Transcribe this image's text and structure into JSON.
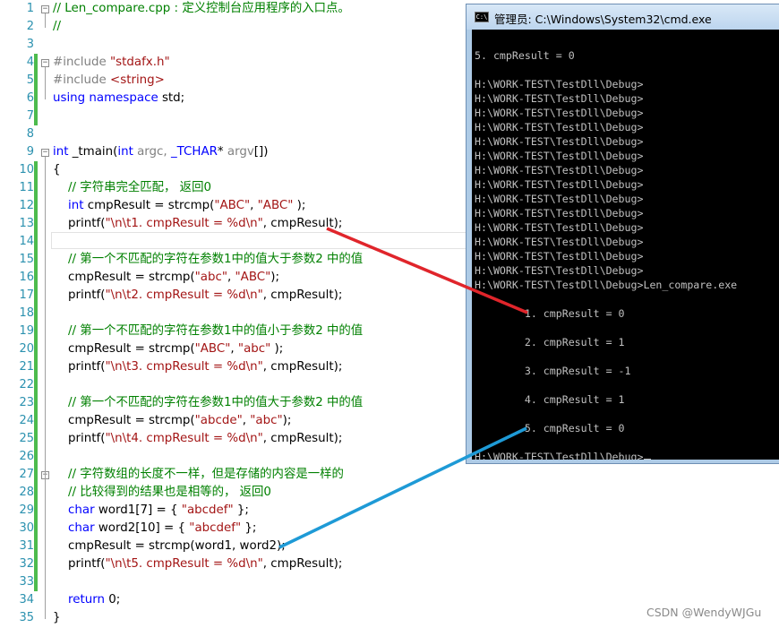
{
  "editor": {
    "lines": [
      {
        "n": "1",
        "segs": [
          {
            "t": "// Len_compare.cpp : 定义控制台应用程序的入口点。",
            "c": "cm"
          }
        ]
      },
      {
        "n": "2",
        "segs": [
          {
            "t": "//",
            "c": "cm"
          }
        ]
      },
      {
        "n": "3",
        "segs": []
      },
      {
        "n": "4",
        "segs": [
          {
            "t": "#include ",
            "c": "pp"
          },
          {
            "t": "\"stdafx.h\"",
            "c": "str"
          }
        ]
      },
      {
        "n": "5",
        "segs": [
          {
            "t": "#include ",
            "c": "pp"
          },
          {
            "t": "<string>",
            "c": "str"
          }
        ]
      },
      {
        "n": "6",
        "segs": [
          {
            "t": "using namespace ",
            "c": "kw"
          },
          {
            "t": "std;",
            "c": ""
          }
        ]
      },
      {
        "n": "7",
        "segs": []
      },
      {
        "n": "8",
        "segs": []
      },
      {
        "n": "9",
        "segs": [
          {
            "t": "int ",
            "c": "kw"
          },
          {
            "t": "_tmain(",
            "c": ""
          },
          {
            "t": "int ",
            "c": "kw"
          },
          {
            "t": "argc, ",
            "c": "pp"
          },
          {
            "t": "_TCHAR",
            "c": "kw"
          },
          {
            "t": "* ",
            "c": ""
          },
          {
            "t": "argv",
            "c": "pp"
          },
          {
            "t": "[])",
            "c": ""
          }
        ]
      },
      {
        "n": "10",
        "segs": [
          {
            "t": "{",
            "c": ""
          }
        ]
      },
      {
        "n": "11",
        "segs": [
          {
            "t": "    // 字符串完全匹配， 返回0",
            "c": "cm"
          }
        ]
      },
      {
        "n": "12",
        "segs": [
          {
            "t": "    ",
            "c": ""
          },
          {
            "t": "int ",
            "c": "kw"
          },
          {
            "t": "cmpResult = strcmp(",
            "c": ""
          },
          {
            "t": "\"ABC\"",
            "c": "str"
          },
          {
            "t": ", ",
            "c": ""
          },
          {
            "t": "\"ABC\"",
            "c": "str"
          },
          {
            "t": " );",
            "c": ""
          }
        ]
      },
      {
        "n": "13",
        "segs": [
          {
            "t": "    printf(",
            "c": ""
          },
          {
            "t": "\"\\n\\t1. cmpResult = %d\\n\"",
            "c": "str"
          },
          {
            "t": ", cmpResult);",
            "c": ""
          }
        ]
      },
      {
        "n": "14",
        "segs": []
      },
      {
        "n": "15",
        "segs": [
          {
            "t": "    // 第一个不匹配的字符在参数1中的值大于参数2 中的值",
            "c": "cm"
          }
        ]
      },
      {
        "n": "16",
        "segs": [
          {
            "t": "    cmpResult = strcmp(",
            "c": ""
          },
          {
            "t": "\"abc\"",
            "c": "str"
          },
          {
            "t": ", ",
            "c": ""
          },
          {
            "t": "\"ABC\"",
            "c": "str"
          },
          {
            "t": ");",
            "c": ""
          }
        ]
      },
      {
        "n": "17",
        "segs": [
          {
            "t": "    printf(",
            "c": ""
          },
          {
            "t": "\"\\n\\t2. cmpResult = %d\\n\"",
            "c": "str"
          },
          {
            "t": ", cmpResult);",
            "c": ""
          }
        ]
      },
      {
        "n": "18",
        "segs": []
      },
      {
        "n": "19",
        "segs": [
          {
            "t": "    // 第一个不匹配的字符在参数1中的值小于参数2 中的值",
            "c": "cm"
          }
        ]
      },
      {
        "n": "20",
        "segs": [
          {
            "t": "    cmpResult = strcmp(",
            "c": ""
          },
          {
            "t": "\"ABC\"",
            "c": "str"
          },
          {
            "t": ", ",
            "c": ""
          },
          {
            "t": "\"abc\"",
            "c": "str"
          },
          {
            "t": " );",
            "c": ""
          }
        ]
      },
      {
        "n": "21",
        "segs": [
          {
            "t": "    printf(",
            "c": ""
          },
          {
            "t": "\"\\n\\t3. cmpResult = %d\\n\"",
            "c": "str"
          },
          {
            "t": ", cmpResult);",
            "c": ""
          }
        ]
      },
      {
        "n": "22",
        "segs": []
      },
      {
        "n": "23",
        "segs": [
          {
            "t": "    // 第一个不匹配的字符在参数1中的值大于参数2 中的值",
            "c": "cm"
          }
        ]
      },
      {
        "n": "24",
        "segs": [
          {
            "t": "    cmpResult = strcmp(",
            "c": ""
          },
          {
            "t": "\"abcde\"",
            "c": "str"
          },
          {
            "t": ", ",
            "c": ""
          },
          {
            "t": "\"abc\"",
            "c": "str"
          },
          {
            "t": ");",
            "c": ""
          }
        ]
      },
      {
        "n": "25",
        "segs": [
          {
            "t": "    printf(",
            "c": ""
          },
          {
            "t": "\"\\n\\t4. cmpResult = %d\\n\"",
            "c": "str"
          },
          {
            "t": ", cmpResult);",
            "c": ""
          }
        ]
      },
      {
        "n": "26",
        "segs": []
      },
      {
        "n": "27",
        "segs": [
          {
            "t": "    // 字符数组的长度不一样，但是存储的内容是一样的",
            "c": "cm"
          }
        ]
      },
      {
        "n": "28",
        "segs": [
          {
            "t": "    // 比较得到的结果也是相等的， 返回0",
            "c": "cm"
          }
        ]
      },
      {
        "n": "29",
        "segs": [
          {
            "t": "    ",
            "c": ""
          },
          {
            "t": "char ",
            "c": "kw"
          },
          {
            "t": "word1[7] = { ",
            "c": ""
          },
          {
            "t": "\"abcdef\"",
            "c": "str"
          },
          {
            "t": " };",
            "c": ""
          }
        ]
      },
      {
        "n": "30",
        "segs": [
          {
            "t": "    ",
            "c": ""
          },
          {
            "t": "char ",
            "c": "kw"
          },
          {
            "t": "word2[10] = { ",
            "c": ""
          },
          {
            "t": "\"abcdef\"",
            "c": "str"
          },
          {
            "t": " };",
            "c": ""
          }
        ]
      },
      {
        "n": "31",
        "segs": [
          {
            "t": "    cmpResult = strcmp(word1, word2);",
            "c": ""
          }
        ]
      },
      {
        "n": "32",
        "segs": [
          {
            "t": "    printf(",
            "c": ""
          },
          {
            "t": "\"\\n\\t5. cmpResult = %d\\n\"",
            "c": "str"
          },
          {
            "t": ", cmpResult);",
            "c": ""
          }
        ]
      },
      {
        "n": "33",
        "segs": []
      },
      {
        "n": "34",
        "segs": [
          {
            "t": "    ",
            "c": ""
          },
          {
            "t": "return ",
            "c": "kw"
          },
          {
            "t": "0;",
            "c": ""
          }
        ]
      },
      {
        "n": "35",
        "segs": [
          {
            "t": "}",
            "c": ""
          }
        ]
      }
    ]
  },
  "cmd": {
    "title": "管理员: C:\\Windows\\System32\\cmd.exe",
    "icon_label": "C:\\",
    "lines": [
      "5. cmpResult = 0",
      "",
      "H:\\WORK-TEST\\TestDll\\Debug>",
      "H:\\WORK-TEST\\TestDll\\Debug>",
      "H:\\WORK-TEST\\TestDll\\Debug>",
      "H:\\WORK-TEST\\TestDll\\Debug>",
      "H:\\WORK-TEST\\TestDll\\Debug>",
      "H:\\WORK-TEST\\TestDll\\Debug>",
      "H:\\WORK-TEST\\TestDll\\Debug>",
      "H:\\WORK-TEST\\TestDll\\Debug>",
      "H:\\WORK-TEST\\TestDll\\Debug>",
      "H:\\WORK-TEST\\TestDll\\Debug>",
      "H:\\WORK-TEST\\TestDll\\Debug>",
      "H:\\WORK-TEST\\TestDll\\Debug>",
      "H:\\WORK-TEST\\TestDll\\Debug>",
      "H:\\WORK-TEST\\TestDll\\Debug>",
      "H:\\WORK-TEST\\TestDll\\Debug>Len_compare.exe",
      "",
      "        1. cmpResult = 0",
      "",
      "        2. cmpResult = 1",
      "",
      "        3. cmpResult = -1",
      "",
      "        4. cmpResult = 1",
      "",
      "        5. cmpResult = 0",
      "",
      "H:\\WORK-TEST\\TestDll\\Debug>"
    ]
  },
  "colors": {
    "keyword": "#0000ff",
    "string": "#a31515",
    "comment": "#008000",
    "line_number": "#2b91af",
    "change_bar": "#4dbb4d",
    "arrow_red": "#e0252b",
    "arrow_blue": "#1e9ad6"
  },
  "watermark": "CSDN @WendyWJGu"
}
